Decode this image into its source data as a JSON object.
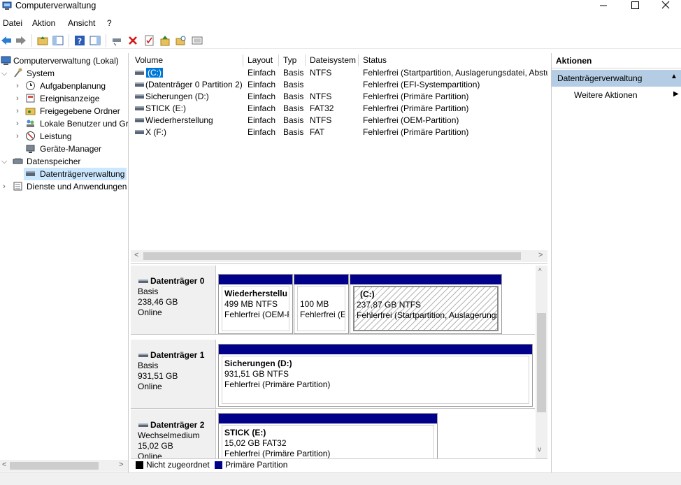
{
  "window": {
    "title": "Computerverwaltung"
  },
  "menu": [
    "Datei",
    "Aktion",
    "Ansicht",
    "?"
  ],
  "tree": {
    "root": "Computerverwaltung (Lokal)",
    "system": "System",
    "items": [
      "Aufgabenplanung",
      "Ereignisanzeige",
      "Freigegebene Ordner",
      "Lokale Benutzer und Gr",
      "Leistung",
      "Geräte-Manager"
    ],
    "storage": "Datenspeicher",
    "storage_item": "Datenträgerverwaltung",
    "services": "Dienste und Anwendungen"
  },
  "volumes": {
    "columns": [
      "Volume",
      "Layout",
      "Typ",
      "Dateisystem",
      "Status"
    ],
    "rows": [
      {
        "volume": "(C:)",
        "layout": "Einfach",
        "typ": "Basis",
        "fs": "NTFS",
        "status": "Fehlerfrei (Startpartition, Auslagerungsdatei, Abstu"
      },
      {
        "volume": "(Datenträger 0 Partition 2)",
        "layout": "Einfach",
        "typ": "Basis",
        "fs": "",
        "status": "Fehlerfrei (EFI-Systempartition)"
      },
      {
        "volume": "Sicherungen (D:)",
        "layout": "Einfach",
        "typ": "Basis",
        "fs": "NTFS",
        "status": "Fehlerfrei (Primäre Partition)"
      },
      {
        "volume": "STICK (E:)",
        "layout": "Einfach",
        "typ": "Basis",
        "fs": "FAT32",
        "status": "Fehlerfrei (Primäre Partition)"
      },
      {
        "volume": "Wiederherstellung",
        "layout": "Einfach",
        "typ": "Basis",
        "fs": "NTFS",
        "status": "Fehlerfrei (OEM-Partition)"
      },
      {
        "volume": "X (F:)",
        "layout": "Einfach",
        "typ": "Basis",
        "fs": "FAT",
        "status": "Fehlerfrei (Primäre Partition)"
      }
    ]
  },
  "disks": [
    {
      "name": "Datenträger 0",
      "type": "Basis",
      "size": "238,46 GB",
      "state": "Online",
      "partitions": [
        {
          "title": "Wiederherstellu",
          "size": "499 MB NTFS",
          "status": "Fehlerfrei (OEM-P"
        },
        {
          "title": "",
          "size": "100 MB",
          "status": "Fehlerfrei (EI"
        },
        {
          "title": "(C:)",
          "size": "237,87 GB NTFS",
          "status": "Fehlerfrei (Startpartition, Auslagerungs"
        }
      ]
    },
    {
      "name": "Datenträger 1",
      "type": "Basis",
      "size": "931,51 GB",
      "state": "Online",
      "partitions": [
        {
          "title": "Sicherungen  (D:)",
          "size": "931,51 GB NTFS",
          "status": "Fehlerfrei (Primäre Partition)"
        }
      ]
    },
    {
      "name": "Datenträger 2",
      "type": "Wechselmedium",
      "size": "15,02 GB",
      "state": "Online",
      "partitions": [
        {
          "title": "STICK  (E:)",
          "size": "15,02 GB FAT32",
          "status": "Fehlerfrei (Primäre Partition)"
        }
      ]
    }
  ],
  "legend": [
    {
      "label": "Nicht zugeordnet",
      "color": "#000000"
    },
    {
      "label": "Primäre Partition",
      "color": "#00008b"
    }
  ],
  "actions": {
    "header": "Aktionen",
    "section": "Datenträgerverwaltung",
    "item": "Weitere Aktionen"
  },
  "colors": {
    "selection": "#0078d7",
    "partition_bar": "#00008b",
    "action_section": "#b4cde4",
    "tree_selection": "#cce8ff"
  }
}
